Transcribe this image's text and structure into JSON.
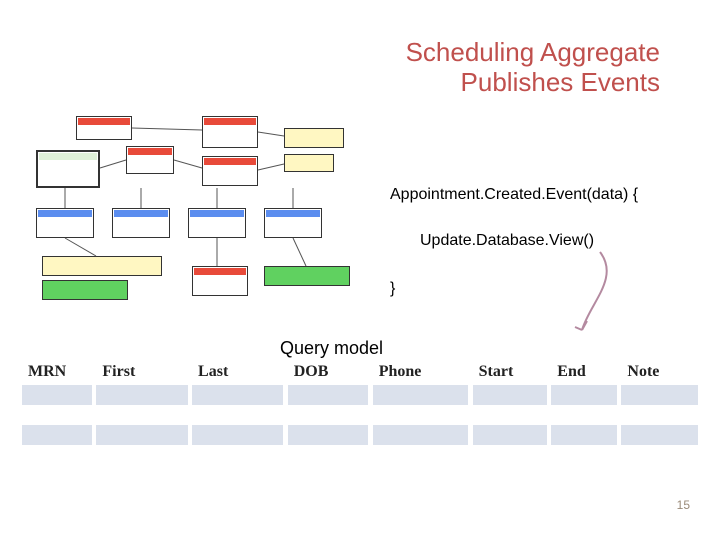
{
  "title": {
    "line1": "Scheduling Aggregate",
    "line2": "Publishes Events"
  },
  "code": {
    "line1": "Appointment.Created.Event(data) {",
    "line2": "Update.Database.View()",
    "line3": "}"
  },
  "query_model_label": "Query model",
  "table": {
    "headers": [
      "MRN",
      "First",
      "Last",
      "DOB",
      "Phone",
      "Start",
      "End",
      "Note"
    ]
  },
  "page_number": "15"
}
